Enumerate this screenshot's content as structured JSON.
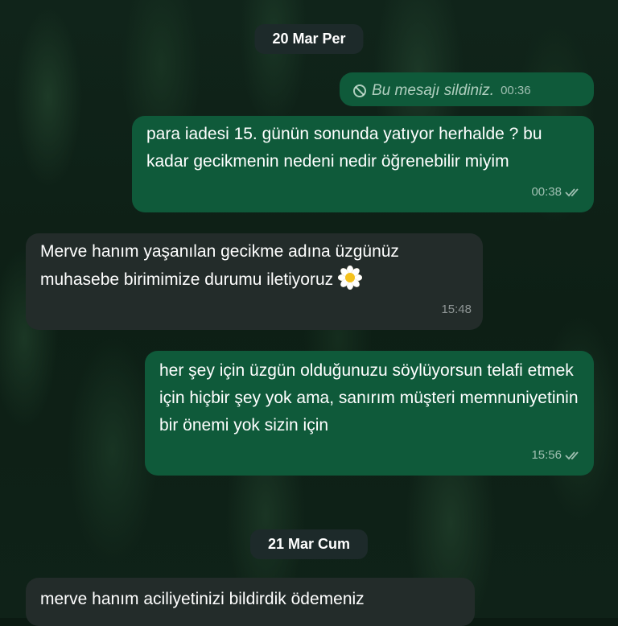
{
  "dates": {
    "first": "20 Mar Per",
    "second": "21 Mar Cum"
  },
  "messages": [
    {
      "direction": "outgoing",
      "deleted": true,
      "text": "Bu mesajı sildiniz.",
      "time": "00:36"
    },
    {
      "direction": "outgoing",
      "text": "para iadesi 15. günün sonunda yatıyor herhalde ? bu kadar gecikmenin nedeni nedir öğrenebilir miyim",
      "time": "00:38",
      "status": "read"
    },
    {
      "direction": "incoming",
      "text": "Merve hanım yaşanılan gecikme adına üzgünüz muhasebe birimimize durumu iletiyoruz",
      "emoji": "sunflower",
      "time": "15:48"
    },
    {
      "direction": "outgoing",
      "text": "her şey için üzgün olduğunuzu söylüyorsun telafi etmek için hiçbir şey yok ama, sanırım müşteri memnuniyetinin bir önemi yok sizin için",
      "time": "15:56",
      "status": "read"
    },
    {
      "direction": "incoming",
      "text": "merve hanım aciliyetinizi bildirdik ödemeniz"
    }
  ],
  "colors": {
    "outgoing_bubble": "#0f5a3a",
    "incoming_bubble": "#232c2a",
    "date_chip": "#1d2a2a"
  },
  "icons": {
    "deleted": "prohibited-icon",
    "read_receipt": "double-check-icon",
    "emoji": "flower-emoji-icon"
  }
}
